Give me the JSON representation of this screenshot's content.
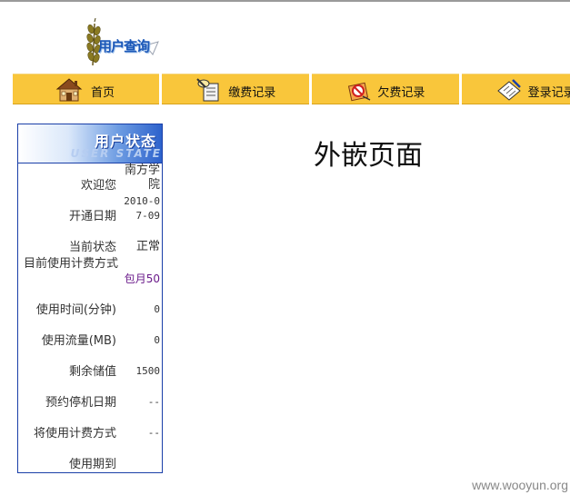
{
  "logo": {
    "text": "用户查询"
  },
  "nav": {
    "items": [
      {
        "label": "首页",
        "icon": "house-icon"
      },
      {
        "label": "缴费记录",
        "icon": "notepad-pen-icon"
      },
      {
        "label": "欠费记录",
        "icon": "forbidden-sign-icon"
      },
      {
        "label": "登录记录",
        "icon": "pen-paper-icon"
      }
    ]
  },
  "panel": {
    "title": "用户状态",
    "subtitle": "USER STATE",
    "rows": [
      {
        "label": "欢迎您",
        "value": "南方学院"
      },
      {
        "label": "开通日期",
        "value": "2010-07-09"
      },
      {
        "label": "当前状态",
        "value": "正常"
      },
      {
        "label": "目前使用计费方式",
        "value": "包月50"
      },
      {
        "label": "使用时间(分钟)",
        "value": "0"
      },
      {
        "label": "使用流量(MB)",
        "value": "0"
      },
      {
        "label": "剩余储值",
        "value": "1500"
      },
      {
        "label": "预约停机日期",
        "value": "--"
      },
      {
        "label": "将使用计费方式",
        "value": "--"
      },
      {
        "label": "使用期到",
        "value": ""
      }
    ]
  },
  "main": {
    "title": "外嵌页面"
  },
  "watermark": "www.wooyun.org",
  "colors": {
    "nav_bg": "#f9c63b",
    "panel_border": "#1a3fa8",
    "panel_head": "#2d62cc",
    "value_purple": "#6a1a8a"
  }
}
